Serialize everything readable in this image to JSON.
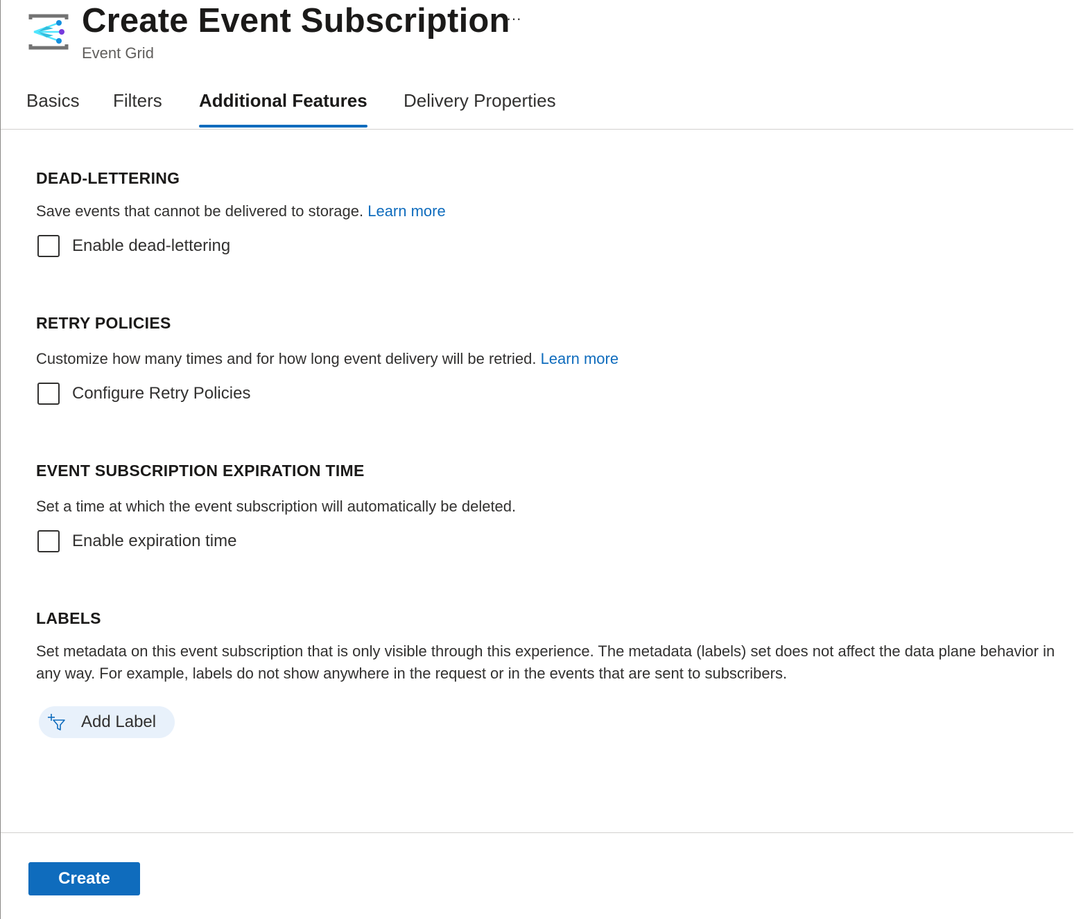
{
  "header": {
    "title": "Create Event Subscription",
    "subtitle": "Event Grid",
    "more_label": "···",
    "service_icon": "event-grid-icon"
  },
  "tabs": [
    {
      "label": "Basics",
      "active": false
    },
    {
      "label": "Filters",
      "active": false
    },
    {
      "label": "Additional Features",
      "active": true
    },
    {
      "label": "Delivery Properties",
      "active": false
    }
  ],
  "sections": {
    "dead_lettering": {
      "heading": "DEAD-LETTERING",
      "description": "Save events that cannot be delivered to storage.",
      "link": "Learn more",
      "checkbox_label": "Enable dead-lettering",
      "checked": false
    },
    "retry_policies": {
      "heading": "RETRY POLICIES",
      "description": "Customize how many times and for how long event delivery will be retried.",
      "link": "Learn more",
      "checkbox_label": "Configure Retry Policies",
      "checked": false
    },
    "expiration": {
      "heading": "EVENT SUBSCRIPTION EXPIRATION TIME",
      "description": "Set a time at which the event subscription will automatically be deleted.",
      "checkbox_label": "Enable expiration time",
      "checked": false
    },
    "labels": {
      "heading": "LABELS",
      "description": "Set metadata on this event subscription that is only visible through this experience. The metadata (labels) set does not affect the data plane behavior in any way. For example, labels do not show anywhere in the request or in the events that are sent to subscribers.",
      "add_button_label": "Add Label",
      "add_button_icon": "add-filter-icon"
    }
  },
  "footer": {
    "create_label": "Create"
  },
  "colors": {
    "accent": "#0f6cbd",
    "text": "#323130",
    "muted": "#605e5c",
    "pill_bg": "#e8f1fb"
  }
}
